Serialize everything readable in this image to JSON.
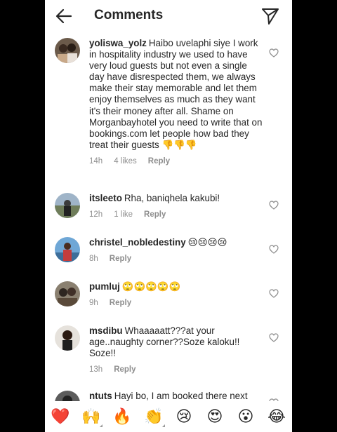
{
  "header": {
    "title": "Comments"
  },
  "comments": [
    {
      "username": "yoliswa_yolz",
      "text": "Haibo uvelaphi siye I work in hospitality industry we used to have very loud guests but not even a single day have disrespected them, we always make their stay memorable and let them enjoy themselves as much as they want it's their money after all. Shame on Morganbayhotel you need to write that on bookings.com let people how bad they treat their guests",
      "trailing_emoji": "👎👎👎",
      "time": "14h",
      "likes": "4 likes",
      "reply": "Reply"
    },
    {
      "username": "itsleeto",
      "text": "Rha, baniqhela kakubi!",
      "trailing_emoji": "",
      "time": "12h",
      "likes": "1 like",
      "reply": "Reply"
    },
    {
      "username": "christel_nobledestiny",
      "text": "",
      "trailing_emoji": "😢😢😢😢",
      "time": "8h",
      "likes": "",
      "reply": "Reply"
    },
    {
      "username": "pumluj",
      "text": "",
      "trailing_emoji": "🙄🙄🙄🙄🙄",
      "time": "9h",
      "likes": "",
      "reply": "Reply"
    },
    {
      "username": "msdibu",
      "text": "Whaaaaatt???at your age..naughty corner??Soze kaloku!! Soze!!",
      "trailing_emoji": "",
      "time": "13h",
      "likes": "",
      "reply": "Reply"
    },
    {
      "username": "ntuts",
      "text": "Hayi bo, I am booked there next",
      "trailing_emoji": "",
      "time": "",
      "likes": "",
      "reply": ""
    }
  ],
  "emoji_bar": [
    "❤️",
    "🙌",
    "🔥",
    "👏",
    "😢",
    "😍",
    "😮",
    "😂"
  ],
  "colors": {
    "text": "#262626",
    "meta": "#8e8e8e",
    "background": "#ffffff",
    "frame": "#000000"
  },
  "icons": {
    "back": "back-arrow-icon",
    "send": "send-icon",
    "like": "heart-outline-icon"
  }
}
